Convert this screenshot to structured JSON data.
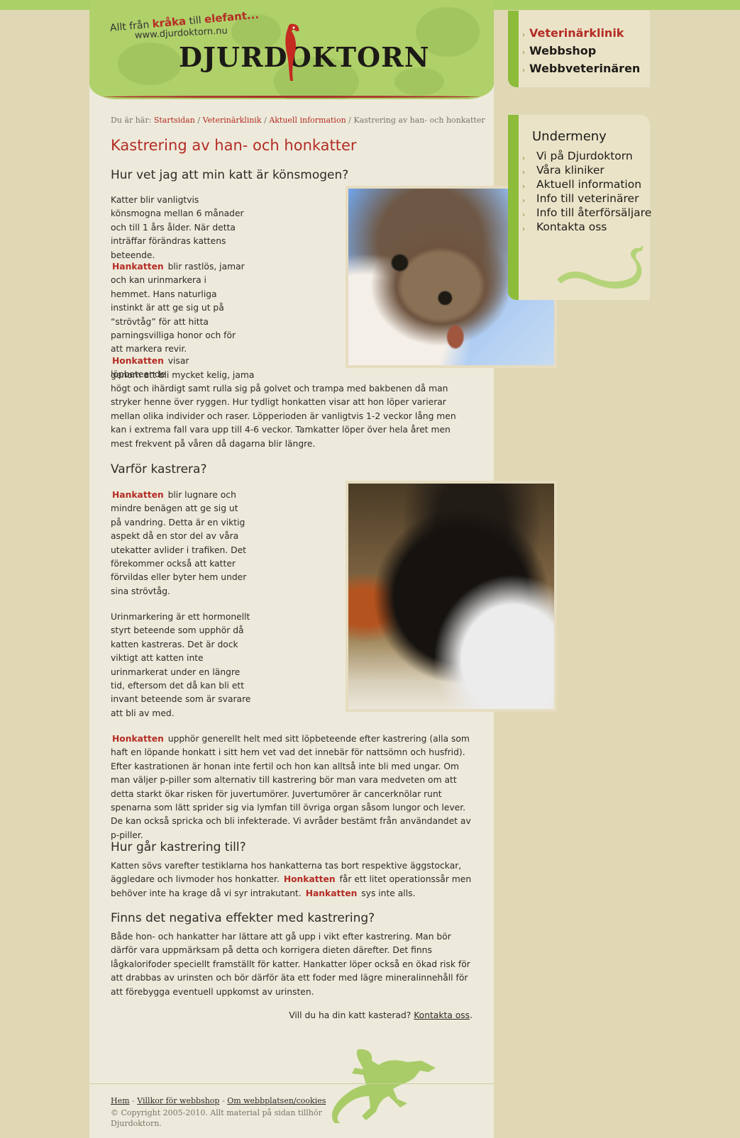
{
  "header": {
    "tagline_pre": "Allt från ",
    "tagline_w1": "kråka",
    "tagline_mid": " till ",
    "tagline_w2": "elefant...",
    "url": "www.djurdoktorn.nu",
    "logo": "DJURDOKTORN"
  },
  "top_nav": [
    "Veterinärklinik",
    "Webbshop",
    "Webbveterinären"
  ],
  "breadcrumb": {
    "prefix": "Du är här: ",
    "links": [
      "Startsidan",
      "Veterinärklinik",
      "Aktuell information"
    ],
    "sep": " / ",
    "current": "Kastrering av han- och honkatter"
  },
  "article": {
    "title": "Kastrering av han- och honkatter",
    "h_konsmogen": "Hur vet jag att min katt är könsmogen?",
    "p1": "Katter blir vanligtvis könsmogna mellan 6 månader och till 1 års ålder. När detta inträffar förändras kattens beteende.",
    "hankatten": "Hankatten",
    "honkatten": "Honkatten",
    "p2": " blir rastlös, jamar och kan urinmarkera i hemmet. Hans naturliga instinkt är att ge sig ut på “strövtåg” för att hitta parningsvilliga honor och för att markera revir.",
    "p3a": " visar löpbeteende",
    "p3b": "genom att bli mycket kelig, jama",
    "p3c": "högt och ihärdigt samt rulla sig på golvet och trampa med bakbenen då man stryker henne över ryggen. Hur tydligt honkatten visar att hon löper varierar mellan olika individer och raser. Löpperioden är vanligtvis 1-2 veckor lång men kan i extrema fall vara upp till 4-6 veckor. Tamkatter löper över hela året men mest frekvent på våren då dagarna blir längre.",
    "h_varfor": "Varför kastrera?",
    "p4": " blir lugnare och mindre benägen att ge sig ut på vandring. Detta är en viktig aspekt då en stor del av våra utekatter avlider i trafiken. Det förekommer också att katter förvildas eller byter hem under sina strövtåg.",
    "p5": "Urinmarkering är ett hormonellt styrt beteende som upphör då katten kastreras. Det är dock viktigt att katten inte urinmarkerat under en längre tid, eftersom det då kan bli ett invant beteende som är svarare att bli av med.",
    "p6": " upphör generellt helt med sitt löpbeteende efter kastrering (alla som haft en löpande honkatt i sitt hem vet vad det innebär för nattsömn och husfrid). Efter kastrationen är honan inte fertil och hon kan alltså inte bli med ungar. Om man väljer p-piller som alternativ till kastrering bör man vara medveten om att detta starkt ökar risken för juvertumörer. Juvertumörer är cancerknölar runt spenarna som lätt sprider sig via lymfan till övriga organ såsom lungor och lever. De kan också spricka och bli infekterade. Vi avråder bestämt från användandet av p-piller.",
    "h_hur": "Hur går kastrering till?",
    "p7": "Katten sövs varefter testiklarna hos hankatterna tas bort respektive äggstockar, äggledare och livmoder hos honkatter. ",
    "p7b": " får ett litet operationssår men behöver inte ha krage då vi syr intrakutant. ",
    "p7c": " sys inte alls.",
    "h_neg": "Finns det negativa effekter med kastrering?",
    "p8": "Både hon- och hankatter har lättare att gå upp i vikt efter kastrering. Man bör därför vara uppmärksam på detta och korrigera dieten därefter. Det finns lågkalorifoder speciellt framställt för katter. Hankatter löper också en ökad risk för att drabbas av urinsten och bör därför äta ett foder med lägre mineralinnehåll för att förebygga eventuell uppkomst av urinsten.",
    "contact_q": "Vill du ha din katt kasterad? ",
    "contact_link": "Kontakta oss",
    "contact_end": "."
  },
  "submenu": {
    "title": "Undermeny",
    "items": [
      "Vi på Djurdoktorn",
      "Våra kliniker",
      "Aktuell information",
      "Info till veterinärer",
      "Info till återförsäljare",
      "Kontakta oss"
    ]
  },
  "footer": {
    "links": [
      "Hem",
      "Villkor för webbshop",
      "Om webbplatsen/cookies"
    ],
    "sep": " - ",
    "copyright": "© Copyright 2005-2010. Allt material på sidan tillhör Djurdoktorn."
  },
  "colors": {
    "brand_red": "#b42c24",
    "green": "#8dbc3b",
    "header_green": "#b0d06a"
  }
}
